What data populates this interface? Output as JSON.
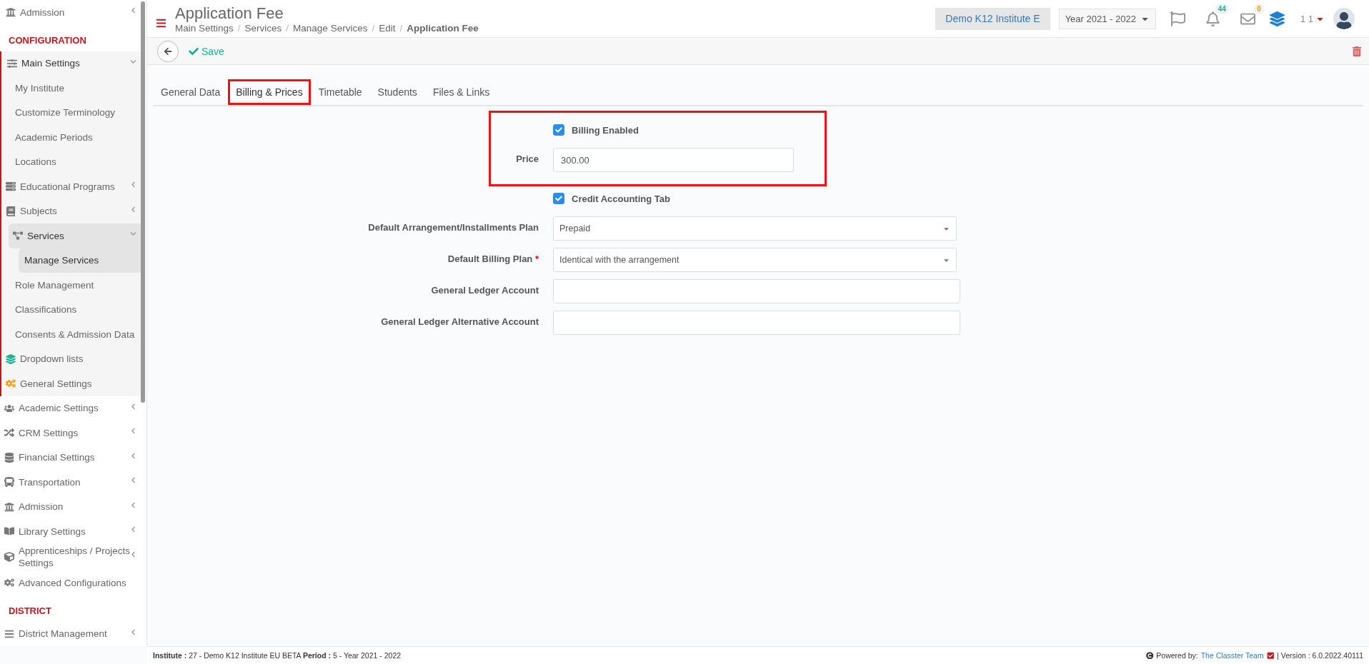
{
  "sidebar": {
    "top_items": [
      {
        "label": "Admission",
        "expanded": false,
        "selected": false
      }
    ],
    "sections": [
      {
        "title": "CONFIGURATION",
        "items": [
          {
            "label": "Main Settings",
            "expanded": true,
            "selected": false,
            "children": [
              {
                "label": "My Institute",
                "selected": false
              },
              {
                "label": "Customize Terminology",
                "selected": false
              },
              {
                "label": "Academic Periods",
                "selected": false
              },
              {
                "label": "Locations",
                "selected": false
              },
              {
                "label": "Educational Programs",
                "expanded": false,
                "selected": false
              },
              {
                "label": "Subjects",
                "expanded": false,
                "selected": false
              },
              {
                "label": "Services",
                "expanded": true,
                "selected": true,
                "children": [
                  {
                    "label": "Manage Services",
                    "selected": true
                  }
                ]
              },
              {
                "label": "Role Management",
                "selected": false
              },
              {
                "label": "Classifications",
                "selected": false
              },
              {
                "label": "Consents & Admission Data",
                "selected": false
              },
              {
                "label": "Dropdown lists",
                "selected": false
              },
              {
                "label": "General Settings",
                "selected": false
              }
            ]
          },
          {
            "label": "Academic Settings",
            "expanded": false,
            "selected": false
          },
          {
            "label": "CRM Settings",
            "expanded": false,
            "selected": false
          },
          {
            "label": "Financial Settings",
            "expanded": false,
            "selected": false
          },
          {
            "label": "Transportation",
            "expanded": false,
            "selected": false
          },
          {
            "label": "Admission",
            "expanded": false,
            "selected": false
          },
          {
            "label": "Library Settings",
            "expanded": false,
            "selected": false
          },
          {
            "label": "Apprenticeships / Projects Settings",
            "expanded": false,
            "selected": false
          },
          {
            "label": "Advanced Configurations",
            "selected": false
          }
        ]
      },
      {
        "title": "DISTRICT",
        "items": [
          {
            "label": "District Management",
            "expanded": false,
            "selected": false
          }
        ]
      }
    ]
  },
  "header": {
    "title": "Application Fee",
    "breadcrumbs": [
      "Main Settings",
      "Services",
      "Manage Services",
      "Edit",
      "Application Fee"
    ],
    "breadcrumb_separators": [
      "/",
      "/",
      "/",
      "/"
    ],
    "institute": "Demo K12 Institute E",
    "year": "Year 2021 - 2022",
    "notifications": "44",
    "messages": "0",
    "user": "1 1"
  },
  "toolbar": {
    "save": "Save"
  },
  "tabs": [
    {
      "label": "General Data",
      "selected": false
    },
    {
      "label": "Billing & Prices",
      "selected": true
    },
    {
      "label": "Timetable",
      "selected": false
    },
    {
      "label": "Students",
      "selected": false
    },
    {
      "label": "Files & Links",
      "selected": false
    }
  ],
  "form": {
    "groups": [
      {
        "highlighted": true,
        "rows": [
          {
            "kind": "checkbox",
            "label": "Billing Enabled",
            "checked": true
          },
          {
            "kind": "short_text",
            "label": "Price",
            "value": "300.00"
          }
        ]
      },
      {
        "rows": [
          {
            "kind": "checkbox",
            "label": "Credit Accounting Tab",
            "checked": true
          },
          {
            "kind": "select",
            "label": "Default Arrangement/Installments Plan",
            "value": "Prepaid"
          },
          {
            "kind": "select",
            "label": "Default Billing Plan",
            "required_mark": "*",
            "value": "Identical with the arrangement"
          },
          {
            "kind": "text",
            "label": "General Ledger Account"
          },
          {
            "kind": "text",
            "label": "General Ledger Alternative Account"
          }
        ]
      }
    ]
  },
  "footer": {
    "info": "**Institute :** 27 - Demo K12 Institute EU BETA **Period :** 5 - Year 2021 - 2022",
    "powered": "Powered by:",
    "team": "The Classter Team",
    "version": "| Version : 6.0.2022.40111"
  }
}
